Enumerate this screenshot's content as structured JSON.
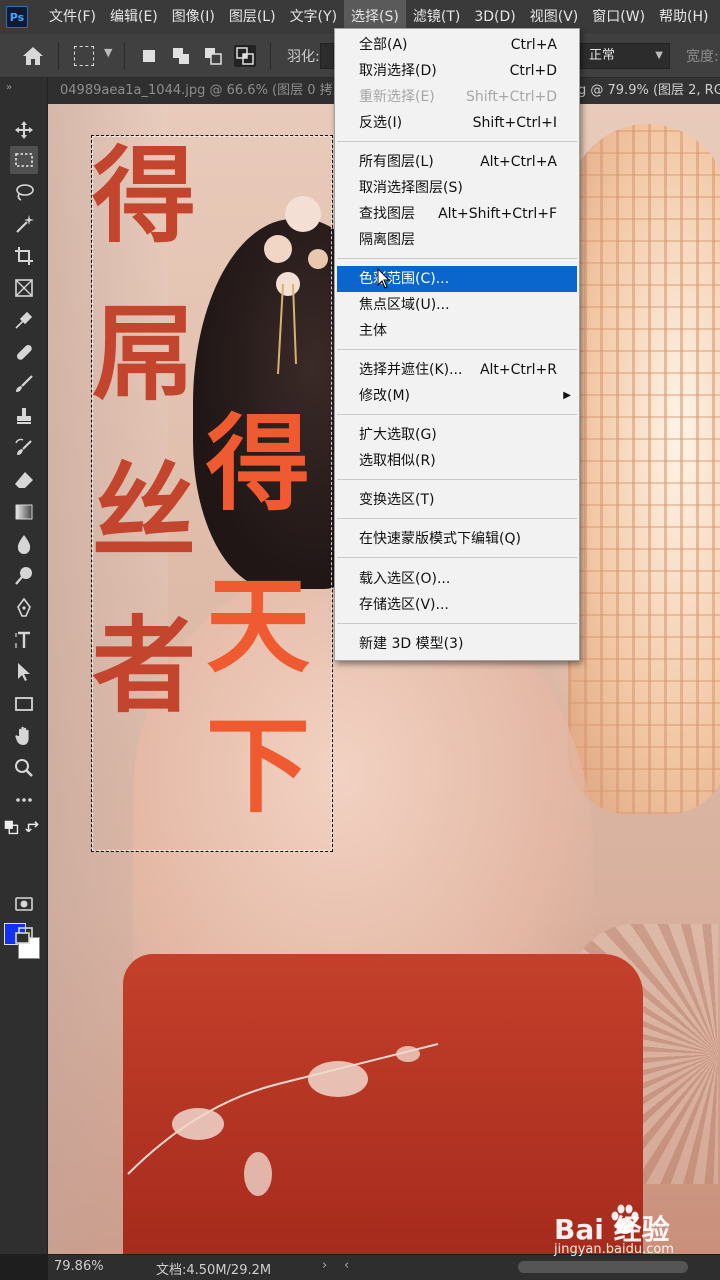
{
  "app": {
    "logo_text": "Ps"
  },
  "menubar": {
    "items": [
      "文件(F)",
      "编辑(E)",
      "图像(I)",
      "图层(L)",
      "文字(Y)",
      "选择(S)",
      "滤镜(T)",
      "3D(D)",
      "视图(V)",
      "窗口(W)",
      "帮助(H)"
    ],
    "active_index": 5
  },
  "options": {
    "feather_label": "羽化:",
    "style_value": "正常",
    "width_label": "宽度:"
  },
  "tabs": {
    "inactive": "04989aea1a_1044.jpg @ 66.6% (图层 0 拷贝",
    "active": "g @ 79.9% (图层 2, RGB"
  },
  "canvas": {
    "calligraphy_left": [
      "得",
      "屌",
      "丝",
      "者"
    ],
    "calligraphy_right": [
      "得",
      "天",
      "下"
    ]
  },
  "select_menu": {
    "items": [
      {
        "label": "全部(A)",
        "shortcut": "Ctrl+A"
      },
      {
        "label": "取消选择(D)",
        "shortcut": "Ctrl+D"
      },
      {
        "label": "重新选择(E)",
        "shortcut": "Shift+Ctrl+D",
        "disabled": true
      },
      {
        "label": "反选(I)",
        "shortcut": "Shift+Ctrl+I"
      },
      {
        "label": "所有图层(L)",
        "shortcut": "Alt+Ctrl+A"
      },
      {
        "label": "取消选择图层(S)",
        "shortcut": ""
      },
      {
        "label": "查找图层",
        "shortcut": "Alt+Shift+Ctrl+F"
      },
      {
        "label": "隔离图层",
        "shortcut": ""
      },
      {
        "label": "色彩范围(C)...",
        "shortcut": "",
        "highlighted": true
      },
      {
        "label": "焦点区域(U)...",
        "shortcut": ""
      },
      {
        "label": "主体",
        "shortcut": ""
      },
      {
        "label": "选择并遮住(K)...",
        "shortcut": "Alt+Ctrl+R"
      },
      {
        "label": "修改(M)",
        "shortcut": "",
        "submenu": true
      },
      {
        "label": "扩大选取(G)",
        "shortcut": ""
      },
      {
        "label": "选取相似(R)",
        "shortcut": ""
      },
      {
        "label": "变换选区(T)",
        "shortcut": ""
      },
      {
        "label": "在快速蒙版模式下编辑(Q)",
        "shortcut": ""
      },
      {
        "label": "载入选区(O)...",
        "shortcut": ""
      },
      {
        "label": "存储选区(V)...",
        "shortcut": ""
      },
      {
        "label": "新建 3D 模型(3)",
        "shortcut": ""
      }
    ]
  },
  "colors": {
    "foreground": "#1130f0",
    "background": "#ffffff",
    "menu_highlight": "#0a66cc"
  },
  "status": {
    "zoom": "79.86%",
    "doc_size": "文档:4.50M/29.2M"
  },
  "watermark": {
    "brand": "Bai  经验",
    "url": "jingyan.baidu.com"
  }
}
